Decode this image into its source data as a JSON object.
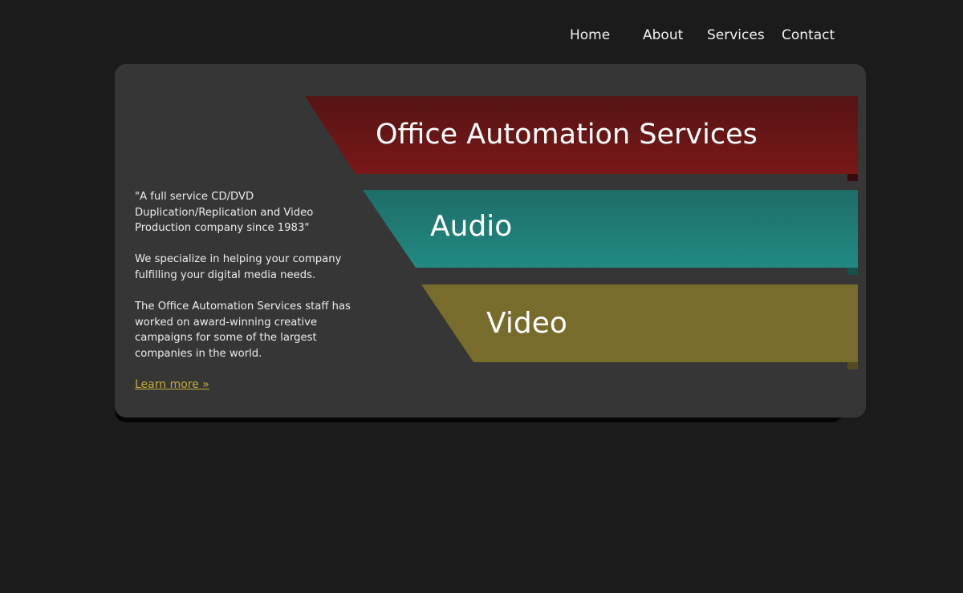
{
  "nav": {
    "items": [
      "Home",
      "About",
      "Services",
      "Contact"
    ]
  },
  "intro": {
    "tagline": "\"A full service CD/DVD Duplication/Replication and Video Production company since 1983\"",
    "paragraph1": "We specialize in helping your company fulfilling your digital media needs.",
    "paragraph2": "The Office Automation Services staff has worked on award-winning creative campaigns for some of the largest companies in the world.",
    "learn_more": "Learn more »"
  },
  "banners": [
    {
      "label": "Office Automation Services",
      "color": "#6a1515"
    },
    {
      "label": "Audio",
      "color": "#207d77"
    },
    {
      "label": "Video",
      "color": "#776c2c"
    }
  ],
  "colors": {
    "background": "#1b1b1b",
    "card": "#363636",
    "link": "#c3ad33"
  }
}
